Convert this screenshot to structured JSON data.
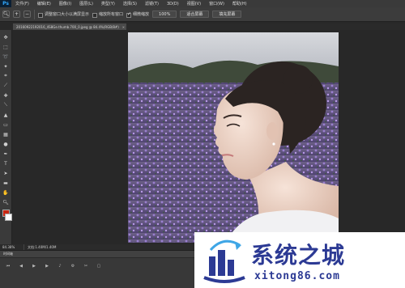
{
  "app": {
    "logo": "Ps"
  },
  "menu": [
    "文件(F)",
    "编辑(E)",
    "图像(I)",
    "图层(L)",
    "类型(Y)",
    "选择(S)",
    "滤镜(T)",
    "3D(D)",
    "视图(V)",
    "窗口(W)",
    "帮助(H)"
  ],
  "options": {
    "resize_windows": "调整窗口大小以满屏显示",
    "zoom_all_windows": "缩放所有窗口",
    "scrubby_zoom": "细微缩放",
    "button_100": "100%",
    "button_fit_screen": "适合屏幕",
    "button_fill_screen": "填充屏幕"
  },
  "document_tab": {
    "title": "20160922192016_4S8Ge.thumb.700_0.jpeg @ 84.4%(RGB/8#)",
    "close": "×"
  },
  "status": {
    "zoom": "84.38%",
    "doc": "文档:1.40M/1.40M"
  },
  "timeline": {
    "title": "时间轴"
  },
  "watermark": {
    "title": "系统之城",
    "url": "xitong86.com"
  },
  "colors": {
    "foreground": "#c92612",
    "background": "#ffffff",
    "watermark_blue": "#2c3a94"
  }
}
